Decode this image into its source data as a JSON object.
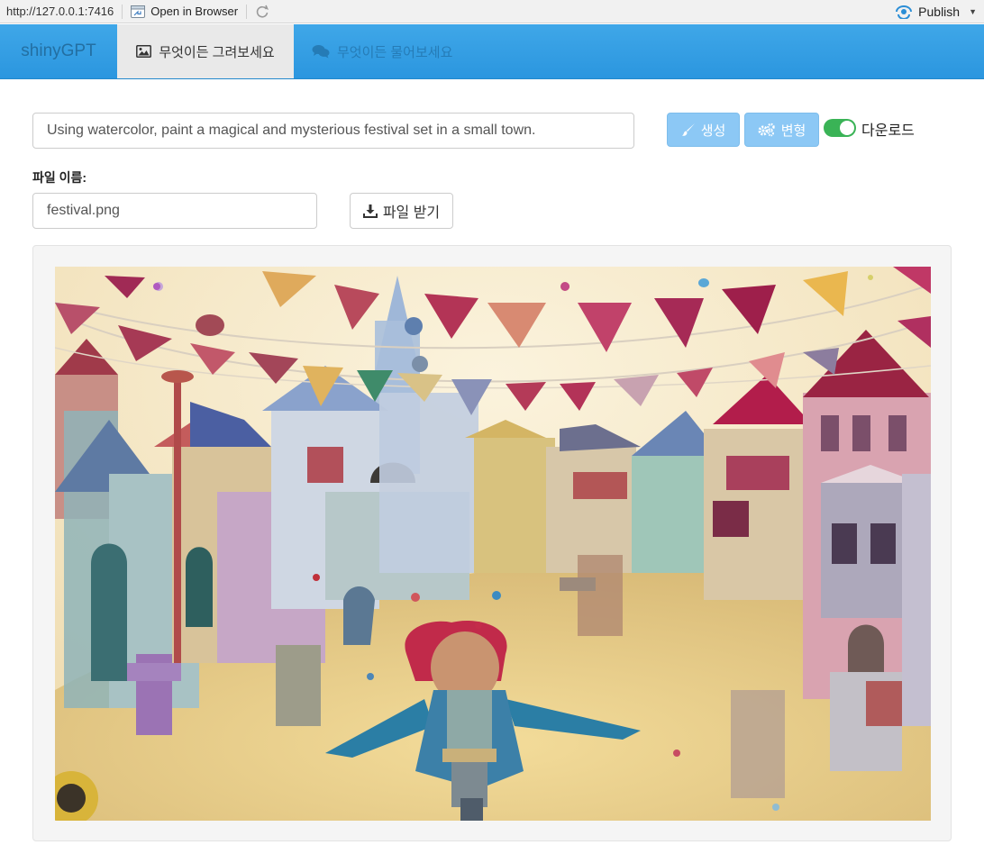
{
  "viewer": {
    "url": "http://127.0.0.1:7416",
    "open_in_browser": "Open in Browser",
    "publish": "Publish"
  },
  "navbar": {
    "brand": "shinyGPT",
    "tabs": [
      {
        "label": "무엇이든 그려보세요",
        "icon": "image-icon",
        "active": true
      },
      {
        "label": "무엇이든 물어보세요",
        "icon": "comments-icon",
        "active": false
      }
    ]
  },
  "form": {
    "prompt_value": "Using watercolor, paint a magical and mysterious festival set in a small town.",
    "generate_label": "생성",
    "variant_label": "변형",
    "download_toggle_label": "다운로드",
    "download_toggle_on": true,
    "file_name_label": "파일 이름:",
    "file_name_value": "festival.png",
    "get_file_label": "파일 받기"
  },
  "colors": {
    "navbar": "#2b96df",
    "button_primary": "#8cc8f5",
    "toggle_on": "#3ab356"
  },
  "image": {
    "description_icon": "watercolor-festival-image"
  }
}
